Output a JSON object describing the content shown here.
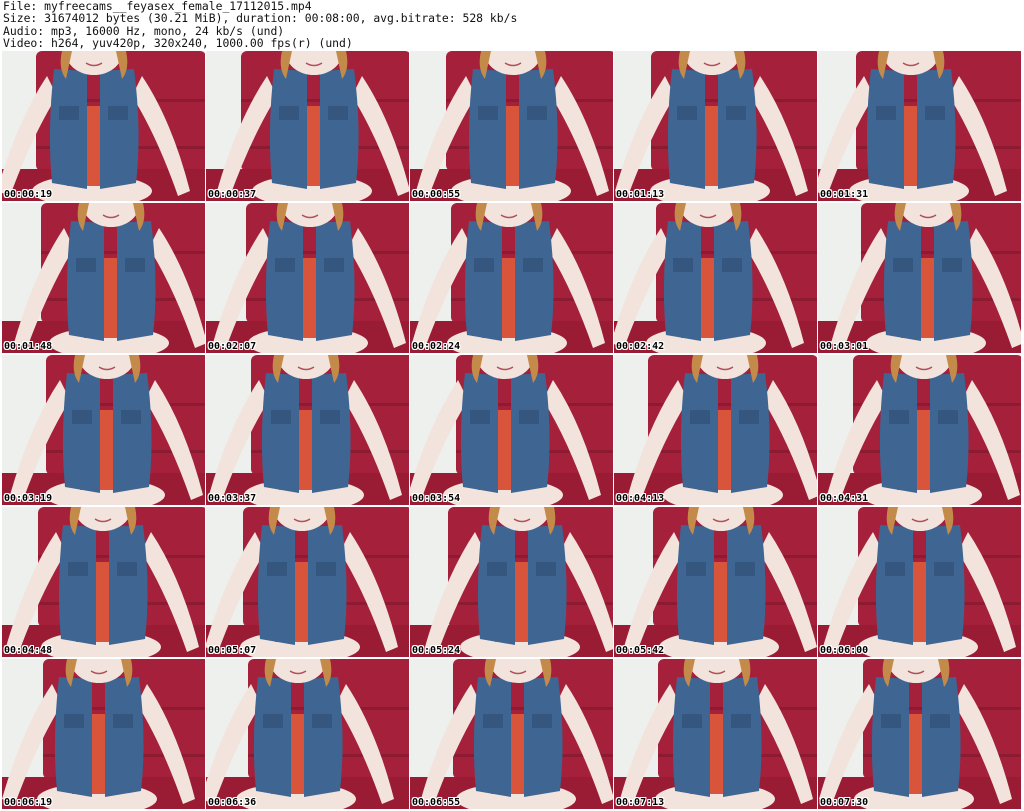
{
  "header": {
    "file": "File: myfreecams__feyasex_female_17112015.mp4",
    "size": "Size: 31674012 bytes (30.21 MiB), duration: 00:08:00, avg.bitrate: 528 kb/s",
    "audio": "Audio: mp3, 16000 Hz, mono, 24 kb/s (und)",
    "video": "Video: h264, yuv420p, 320x240, 1000.00 fps(r) (und)"
  },
  "colors": {
    "background": "#ffffff",
    "couch": "#a5203a",
    "wall": "#eef0ee",
    "denim": "#3f6593",
    "top": "#d8553c",
    "skin": "#f2e4dc",
    "hair": "#c48a4a"
  },
  "thumbnails": [
    {
      "time": "00:00:19"
    },
    {
      "time": "00:00:37"
    },
    {
      "time": "00:00:55"
    },
    {
      "time": "00:01:13"
    },
    {
      "time": "00:01:31"
    },
    {
      "time": "00:01:48"
    },
    {
      "time": "00:02:07"
    },
    {
      "time": "00:02:24"
    },
    {
      "time": "00:02:42"
    },
    {
      "time": "00:03:01"
    },
    {
      "time": "00:03:19"
    },
    {
      "time": "00:03:37"
    },
    {
      "time": "00:03:54"
    },
    {
      "time": "00:04:13"
    },
    {
      "time": "00:04:31"
    },
    {
      "time": "00:04:48"
    },
    {
      "time": "00:05:07"
    },
    {
      "time": "00:05:24"
    },
    {
      "time": "00:05:42"
    },
    {
      "time": "00:06:00"
    },
    {
      "time": "00:06:19"
    },
    {
      "time": "00:06:36"
    },
    {
      "time": "00:06:55"
    },
    {
      "time": "00:07:13"
    },
    {
      "time": "00:07:30"
    }
  ]
}
